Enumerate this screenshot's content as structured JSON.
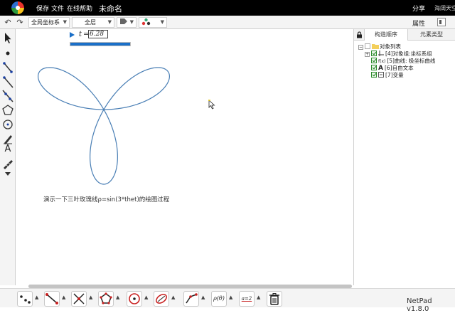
{
  "titlebar": {
    "menu": [
      "保存",
      "文件",
      "在线帮助"
    ],
    "doc_title": "未命名",
    "share_label": "分享",
    "user_name": "海阔天空"
  },
  "toolbar": {
    "coord_system": "全局坐标系",
    "layer": "全层",
    "properties_label": "属性"
  },
  "left_tools": [
    "select-arrow-icon",
    "point-icon",
    "segment-icon",
    "ray-icon",
    "line-icon",
    "polygon-icon",
    "circle-icon",
    "pen-icon",
    "text-icon",
    "ruler-icon",
    "more-icon"
  ],
  "canvas": {
    "anim_var": "t",
    "anim_eq": "=",
    "anim_value": "6.28",
    "anim_progress": 1.0,
    "curve": {
      "formula": "ρ=sin(3*t)",
      "petals": 3,
      "color": "#4a7fb5"
    },
    "caption": "演示一下三叶玫瑰线ρ=sin(3*thet)的绘图过程"
  },
  "right_panel": {
    "tabs": [
      "构造顺序",
      "元素类型"
    ],
    "tree_root": "对象列表",
    "items": [
      {
        "label": "[4]对象组:坐标系组",
        "icon": "axis-icon",
        "checked": true,
        "expandable": true
      },
      {
        "label": "[5]曲线: 极坐标曲线",
        "icon": "curve-icon",
        "checked": true,
        "expandable": false
      },
      {
        "label": "[6]自由文本",
        "icon": "text-icon",
        "checked": true,
        "expandable": false
      },
      {
        "label": "[7]变量",
        "icon": "variable-icon",
        "checked": true,
        "expandable": false
      }
    ]
  },
  "bottom_tools": [
    "point-tool",
    "segment-tool",
    "intersection-tool",
    "polygon-tool",
    "circle-tool",
    "transform-tool",
    "measure-tool",
    "function-tool",
    "equation-tool",
    "trash-tool"
  ],
  "footer": {
    "version": "NetPad v1.8.0"
  },
  "colors": {
    "accent": "#1a6fc8",
    "curve": "#4a7fb5",
    "titlebar": "#000000"
  }
}
